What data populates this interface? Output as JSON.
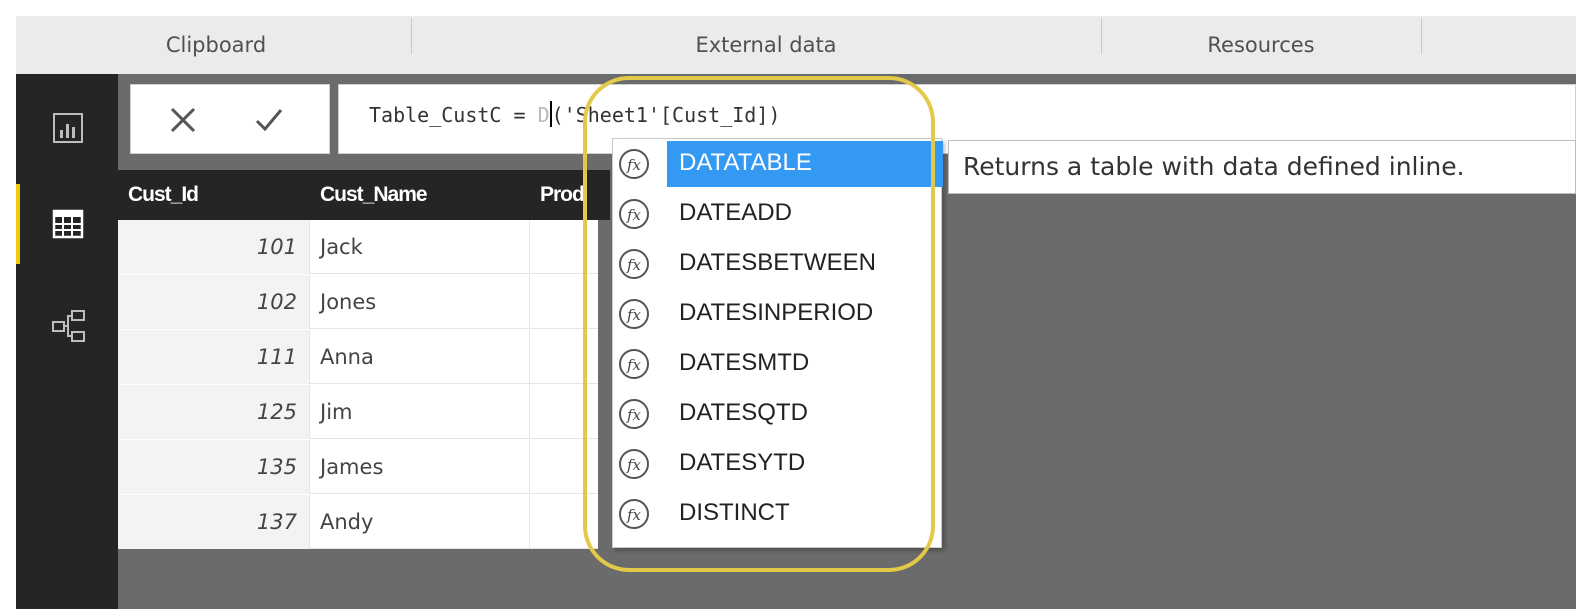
{
  "ribbon": {
    "groups": [
      "Clipboard",
      "External data",
      "Resources"
    ]
  },
  "nav": {
    "items": [
      {
        "name": "report-view",
        "icon": "bar-chart-icon"
      },
      {
        "name": "data-view",
        "icon": "table-grid-icon"
      },
      {
        "name": "relationships-view",
        "icon": "relationship-icon"
      }
    ]
  },
  "formula_bar": {
    "cancel_icon": "close-icon",
    "commit_icon": "checkmark-icon",
    "text_before": "Table_CustC = ",
    "text_typed": "D",
    "text_after": "('Sheet1'[Cust_Id])"
  },
  "table": {
    "columns": [
      "Cust_Id",
      "Cust_Name",
      "Prod"
    ],
    "rows": [
      {
        "id": "101",
        "name": "Jack"
      },
      {
        "id": "102",
        "name": "Jones"
      },
      {
        "id": "111",
        "name": "Anna"
      },
      {
        "id": "125",
        "name": "Jim"
      },
      {
        "id": "135",
        "name": "James"
      },
      {
        "id": "137",
        "name": "Andy"
      }
    ]
  },
  "autocomplete": {
    "icon": "function-fx-icon",
    "selected": "DATATABLE",
    "items": [
      "DATATABLE",
      "DATEADD",
      "DATESBETWEEN",
      "DATESINPERIOD",
      "DATESMTD",
      "DATESQTD",
      "DATESYTD",
      "DISTINCT"
    ]
  },
  "tooltip": {
    "text": "Returns a table with data defined inline."
  },
  "colors": {
    "selection": "#3399f3",
    "highlight_ring": "#e3c94a",
    "rail_accent": "#f2c811"
  }
}
